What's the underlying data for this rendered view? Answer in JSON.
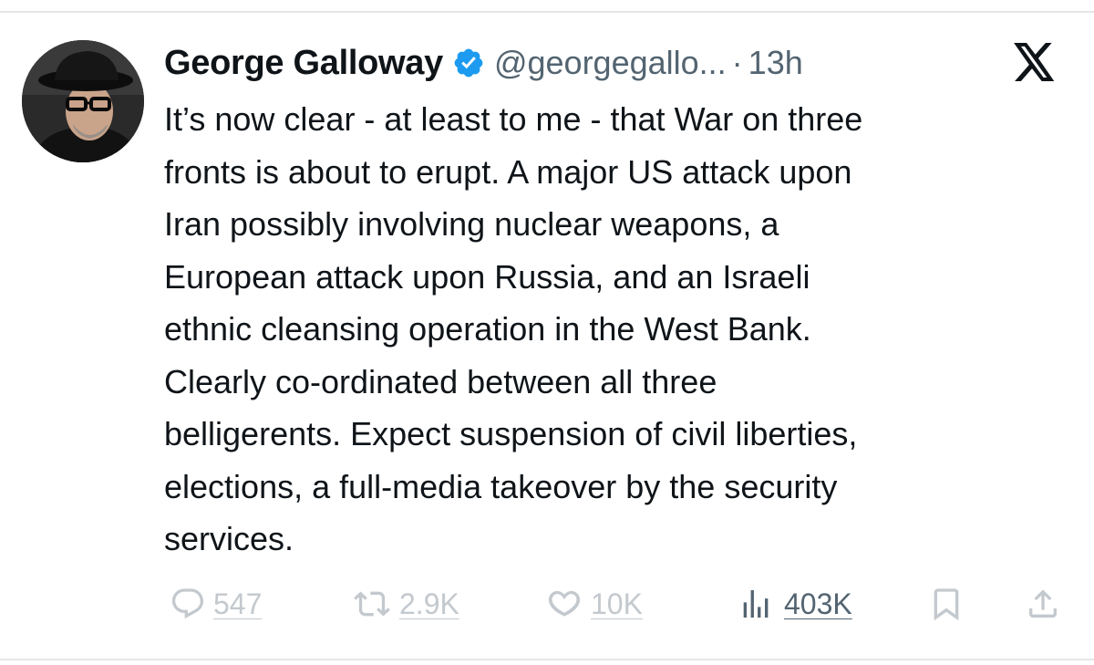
{
  "author": {
    "display_name": "George Galloway",
    "handle": "@georgegallo...",
    "separator": "·",
    "time": "13h",
    "verified": true,
    "verified_color": "#1d9bf0"
  },
  "platform_icon": "x-logo-icon",
  "tweet": {
    "text": "It’s now clear - at least to me - that War on three\nfronts is about to erupt. A major US attack upon\nIran possibly involving nuclear weapons, a\nEuropean attack upon Russia, and an Israeli\nethnic cleansing operation in the West Bank.\nClearly co-ordinated between all three\nbelligerents. Expect suspension of civil liberties,\nelections, a full-media takeover by the security\nservices."
  },
  "actions": {
    "reply": {
      "icon": "reply-icon",
      "count": "547"
    },
    "repost": {
      "icon": "repost-icon",
      "count": "2.9K"
    },
    "like": {
      "icon": "heart-icon",
      "count": "10K"
    },
    "views": {
      "icon": "views-chart-icon",
      "count": "403K"
    },
    "bookmark": {
      "icon": "bookmark-icon"
    },
    "share": {
      "icon": "share-icon"
    }
  },
  "colors": {
    "text_primary": "#0f1419",
    "text_secondary": "#536471",
    "action_muted": "#c3c9ce",
    "divider": "#e6e6e6"
  }
}
